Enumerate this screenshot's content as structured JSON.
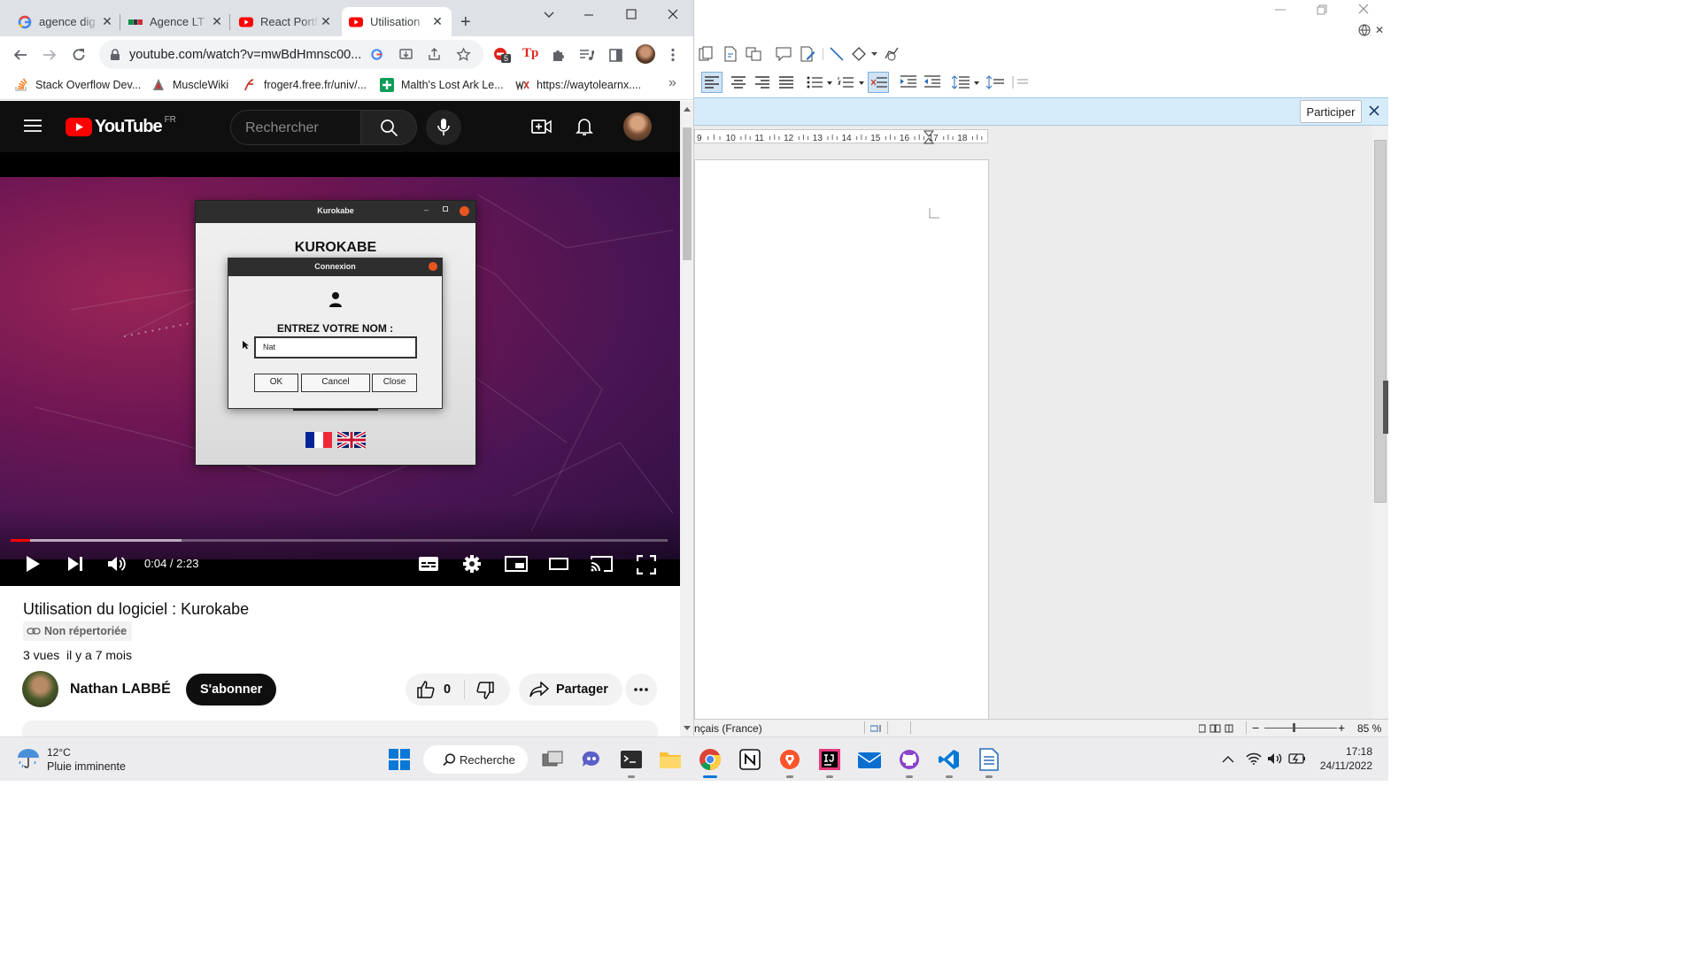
{
  "chrome": {
    "tabs": [
      {
        "title": "agence dig",
        "icon": "google-icon"
      },
      {
        "title": "Agence LT",
        "icon": "site-favicon"
      },
      {
        "title": "React Portf",
        "icon": "youtube-icon"
      },
      {
        "title": "Utilisation",
        "icon": "youtube-icon",
        "active": true
      }
    ],
    "url": "youtube.com/watch?v=mwBdHmnsc00...",
    "extension_badge": "5",
    "bookmarks": [
      {
        "label": "Stack Overflow Dev...",
        "icon": "stackoverflow-icon"
      },
      {
        "label": "MuscleWiki",
        "icon": "musclewiki-icon"
      },
      {
        "label": "froger4.free.fr/univ/...",
        "icon": "froger-icon"
      },
      {
        "label": "Malth's Lost Ark Le...",
        "icon": "plus-icon"
      },
      {
        "label": "https://waytolearnx....",
        "icon": "waytolearnx-icon"
      }
    ],
    "overflow": "»"
  },
  "youtube": {
    "logo_text": "YouTube",
    "country": "FR",
    "search_placeholder": "Rechercher",
    "video": {
      "time": "0:04 / 2:23",
      "progress": 0.03,
      "buffered": 0.26,
      "app_window_title": "Kurokabe",
      "app_heading": "KUROKABE",
      "dialog_title": "Connexion",
      "prompt": "ENTREZ VOTRE NOM :",
      "input_value": "Nat",
      "buttons": [
        "OK",
        "Cancel",
        "Close"
      ]
    },
    "title": "Utilisation du logiciel : Kurokabe",
    "visibility": "Non répertoriée",
    "views": "3 vues",
    "date": "il y a 7 mois",
    "channel": "Nathan LABBÉ",
    "subscribe": "S'abonner",
    "likes": "0",
    "share": "Partager"
  },
  "writer": {
    "infobar_button": "Participer",
    "ruler_ticks": [
      "9",
      "10",
      "11",
      "12",
      "13",
      "14",
      "15",
      "16",
      "17",
      "18"
    ],
    "status_language": "nçais (France)",
    "zoom": "85 %"
  },
  "taskbar": {
    "weather_temp": "12°C",
    "weather_desc": "Pluie imminente",
    "search": "Recherche",
    "time": "17:18",
    "date": "24/11/2022"
  },
  "colors": {
    "youtube_red": "#ff0000",
    "yt_dark": "#0f0f0f",
    "writer_infobar": "#d7ecfa",
    "taskbar": "#ececef"
  }
}
